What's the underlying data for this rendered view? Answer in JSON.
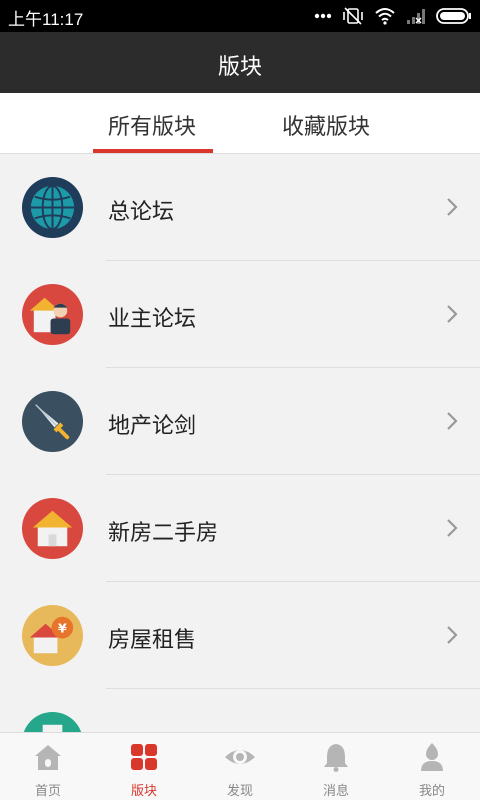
{
  "status_bar": {
    "time": "上午11:17",
    "icons": [
      "more-dots-icon",
      "vibrate-off-icon",
      "wifi-icon",
      "signal-icon",
      "battery-icon"
    ]
  },
  "header": {
    "title": "版块"
  },
  "tabs": [
    {
      "label": "所有版块",
      "active": true
    },
    {
      "label": "收藏版块",
      "active": false
    }
  ],
  "forums": [
    {
      "label": "总论坛",
      "icon": "globe-icon",
      "color": "#1f3c5a"
    },
    {
      "label": "业主论坛",
      "icon": "homeowner-icon",
      "color": "#d9483f"
    },
    {
      "label": "地产论剑",
      "icon": "sword-icon",
      "color": "#3a5060"
    },
    {
      "label": "新房二手房",
      "icon": "house-icon",
      "color": "#d9483f"
    },
    {
      "label": "房屋租售",
      "icon": "house-rent-icon",
      "color": "#e8b95a"
    },
    {
      "label": "",
      "icon": "building-icon",
      "color": "#26a68a"
    }
  ],
  "bottom_nav": [
    {
      "label": "首页",
      "icon": "home-icon",
      "active": false
    },
    {
      "label": "版块",
      "icon": "grid-icon",
      "active": true
    },
    {
      "label": "发现",
      "icon": "eye-icon",
      "active": false
    },
    {
      "label": "消息",
      "icon": "bell-icon",
      "active": false
    },
    {
      "label": "我的",
      "icon": "profile-icon",
      "active": false
    }
  ],
  "colors": {
    "accent": "#d9372b",
    "titlebar": "#2c2c2c"
  }
}
